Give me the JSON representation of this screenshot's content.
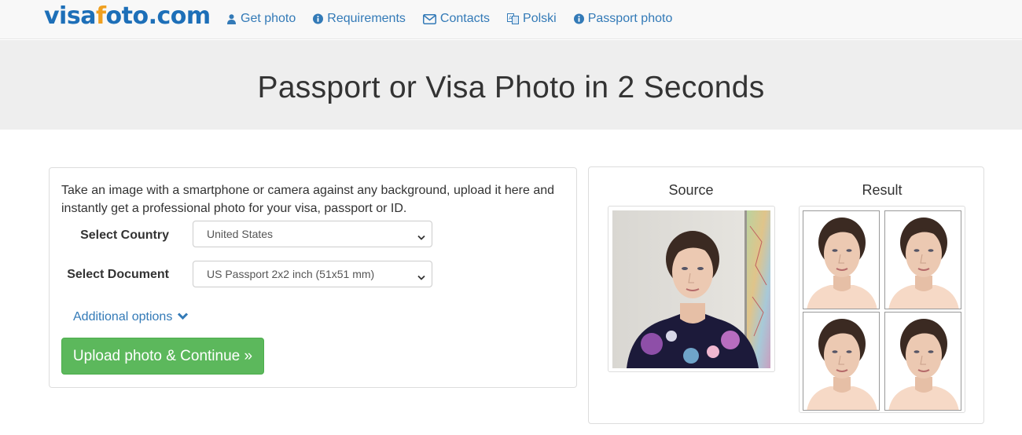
{
  "logo": {
    "part1": "visa",
    "part2": "f",
    "part3": "oto.com"
  },
  "nav": [
    {
      "label": "Get photo",
      "icon": "user-icon"
    },
    {
      "label": "Requirements",
      "icon": "info-circle-icon"
    },
    {
      "label": "Contacts",
      "icon": "envelope-icon"
    },
    {
      "label": "Polski",
      "icon": "language-icon"
    },
    {
      "label": "Passport photo",
      "icon": "info-circle-icon"
    }
  ],
  "hero": {
    "title": "Passport or Visa Photo in 2 Seconds"
  },
  "form": {
    "intro": "Take an image with a smartphone or camera against any background, upload it here and instantly get a professional photo for your visa, passport or ID.",
    "country_label": "Select Country",
    "country_value": "United States",
    "document_label": "Select Document",
    "document_value": "US Passport 2x2 inch (51x51 mm)",
    "additional_options": "Additional options",
    "upload_button": "Upload photo & Continue »"
  },
  "preview": {
    "source_title": "Source",
    "result_title": "Result"
  },
  "colors": {
    "link": "#337ab7",
    "button": "#5cb85c",
    "logo_blue": "#1d6fb8",
    "logo_orange": "#f0a020"
  }
}
